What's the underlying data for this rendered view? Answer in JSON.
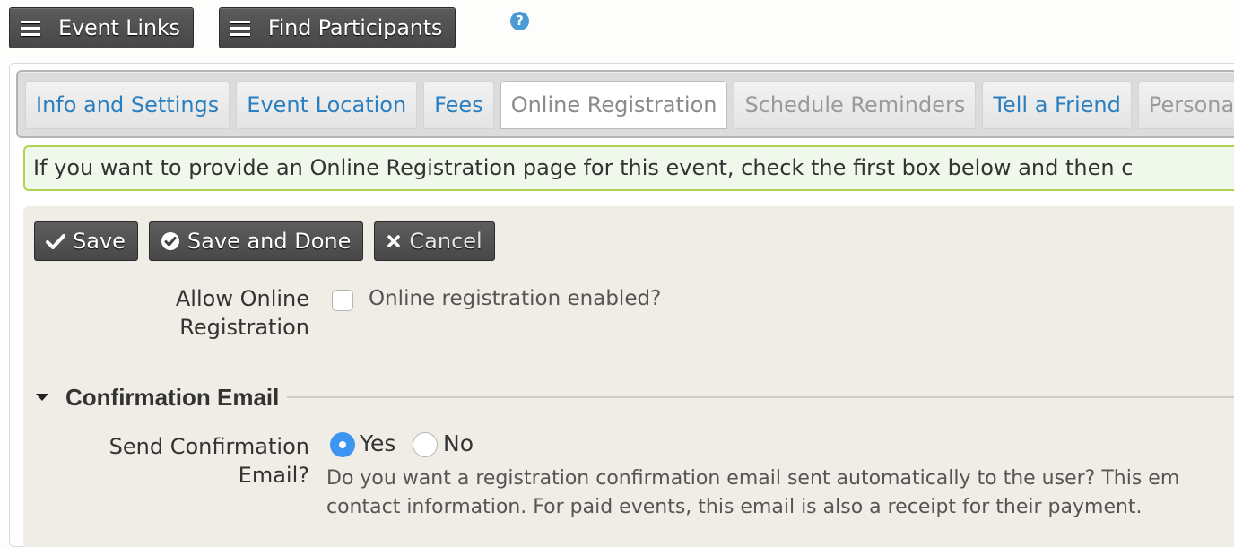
{
  "toolbar": {
    "event_links_label": "Event Links",
    "find_participants_label": "Find Participants",
    "help_icon": "?"
  },
  "tabs": [
    {
      "label": "Info and Settings",
      "state": "link"
    },
    {
      "label": "Event Location",
      "state": "link"
    },
    {
      "label": "Fees",
      "state": "link"
    },
    {
      "label": "Online Registration",
      "state": "active"
    },
    {
      "label": "Schedule Reminders",
      "state": "disabled"
    },
    {
      "label": "Tell a Friend",
      "state": "link"
    },
    {
      "label": "Persona",
      "state": "disabled"
    }
  ],
  "info_message": "If you want to provide an Online Registration page for this event, check the first box below and then c",
  "actions": {
    "save": "Save",
    "save_and_done": "Save and Done",
    "cancel": "Cancel"
  },
  "allow_online": {
    "label_line1": "Allow Online",
    "label_line2": "Registration",
    "checkbox_label": "Online registration enabled?",
    "checked": false
  },
  "confirmation_section": {
    "title": "Confirmation Email",
    "expanded": true,
    "send_label_line1": "Send Confirmation",
    "send_label_line2": "Email?",
    "options": [
      {
        "label": "Yes",
        "selected": true
      },
      {
        "label": "No",
        "selected": false
      }
    ],
    "help_line1": "Do you want a registration confirmation email sent automatically to the user? This em",
    "help_line2": "contact information. For paid events, this email is also a receipt for their payment."
  },
  "colors": {
    "link_blue": "#2a7fc1",
    "info_border": "#b1d24a",
    "radio_selected": "#3b95f1",
    "help_icon": "#4a9ad4"
  }
}
